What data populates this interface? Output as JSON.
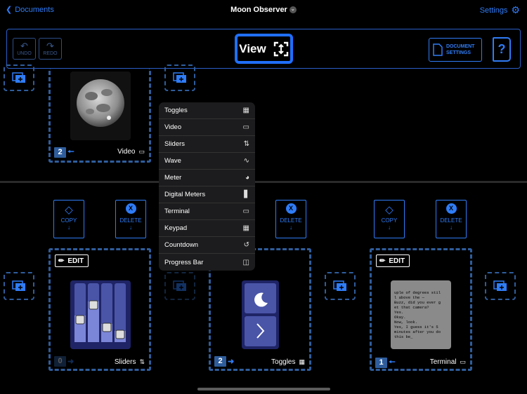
{
  "header": {
    "back_label": "Documents",
    "title": "Moon Observer",
    "settings_label": "Settings"
  },
  "toolbar": {
    "undo": "UNDO",
    "redo": "REDO",
    "view": "View",
    "doc_settings_1": "DOCUMENT",
    "doc_settings_2": "SETTINGS",
    "help": "?"
  },
  "actions": {
    "copy": "COPY",
    "delete": "DELETE",
    "edit": "EDIT"
  },
  "panels": [
    {
      "label": "Video",
      "number": "2"
    },
    {
      "label": "Sliders",
      "number": "0"
    },
    {
      "label": "Toggles",
      "number": "2"
    },
    {
      "label": "Terminal",
      "number": "1"
    }
  ],
  "terminal_text": "uple of degrees stil\nl above the —\nBuzz, did you ever g\net that camera?\nYes.\nOkay.\nNow, look.\nYes, I guess it's 5\nminutes after you do\nthis be_",
  "menu": {
    "items": [
      {
        "label": "Toggles",
        "icon": "grid-icon"
      },
      {
        "label": "Video",
        "icon": "video-icon"
      },
      {
        "label": "Sliders",
        "icon": "sliders-icon"
      },
      {
        "label": "Wave",
        "icon": "wave-icon"
      },
      {
        "label": "Meter",
        "icon": "gauge-icon"
      },
      {
        "label": "Digital Meters",
        "icon": "bar-chart-icon"
      },
      {
        "label": "Terminal",
        "icon": "terminal-icon"
      },
      {
        "label": "Keypad",
        "icon": "keypad-icon"
      },
      {
        "label": "Countdown",
        "icon": "restart-icon"
      },
      {
        "label": "Progress Bar",
        "icon": "progress-icon"
      }
    ]
  },
  "colors": {
    "accent": "#2f7cf6",
    "dashed": "#2f5d9c",
    "menu_bg": "#1c1c1e"
  }
}
